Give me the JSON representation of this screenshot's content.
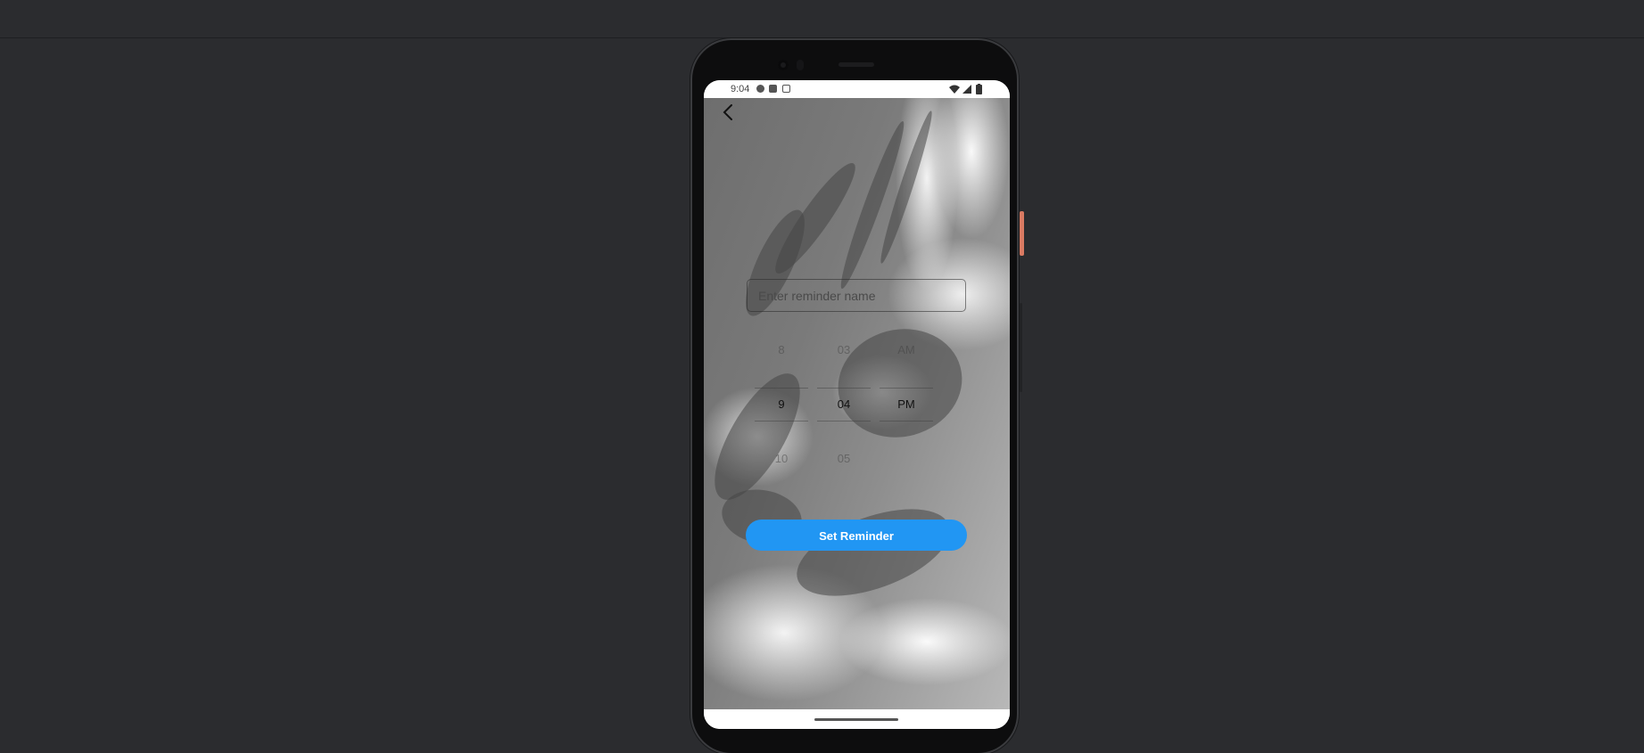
{
  "status_bar": {
    "time": "9:04"
  },
  "reminder": {
    "name_placeholder": "Enter reminder name",
    "name_value": "",
    "button_label": "Set Reminder"
  },
  "time_picker": {
    "hours": {
      "above": "8",
      "selected": "9",
      "below": "10"
    },
    "minutes": {
      "above": "03",
      "selected": "04",
      "below": "05"
    },
    "period": {
      "above": "AM",
      "selected": "PM",
      "below": ""
    }
  },
  "colors": {
    "accent": "#2196f3",
    "device_side_button": "#d97a62",
    "page_background": "#2b2c2f"
  },
  "icons": {
    "back": "back-arrow-icon",
    "wifi": "wifi-icon",
    "signal": "signal-icon",
    "battery": "battery-icon"
  }
}
